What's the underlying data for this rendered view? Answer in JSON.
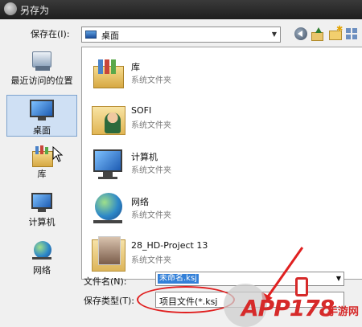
{
  "window": {
    "title": "另存为"
  },
  "location": {
    "label": "保存在(I):",
    "value": "桌面"
  },
  "places": [
    {
      "label": "最近访问的位置"
    },
    {
      "label": "桌面"
    },
    {
      "label": "库"
    },
    {
      "label": "计算机"
    },
    {
      "label": "网络"
    }
  ],
  "files": [
    {
      "name": "库",
      "type": "系统文件夹",
      "icon": "library-icon"
    },
    {
      "name": "SOFI",
      "type": "系统文件夹",
      "icon": "user-folder-icon"
    },
    {
      "name": "计算机",
      "type": "系统文件夹",
      "icon": "computer-icon"
    },
    {
      "name": "网络",
      "type": "系统文件夹",
      "icon": "network-icon"
    },
    {
      "name": "28_HD-Project 13",
      "type": "系统文件夹",
      "icon": "photo-folder-icon"
    }
  ],
  "filename": {
    "label": "文件名(N):",
    "value": "未命名.ksj"
  },
  "filetype": {
    "label": "保存类型(T):",
    "value": "项目文件(*.ksj"
  },
  "watermark": {
    "text": "APP178",
    "suffix": "手游网"
  },
  "colors": {
    "annotation": "#e02020",
    "selection": "#3380d8",
    "brand": "#d62a2a"
  }
}
